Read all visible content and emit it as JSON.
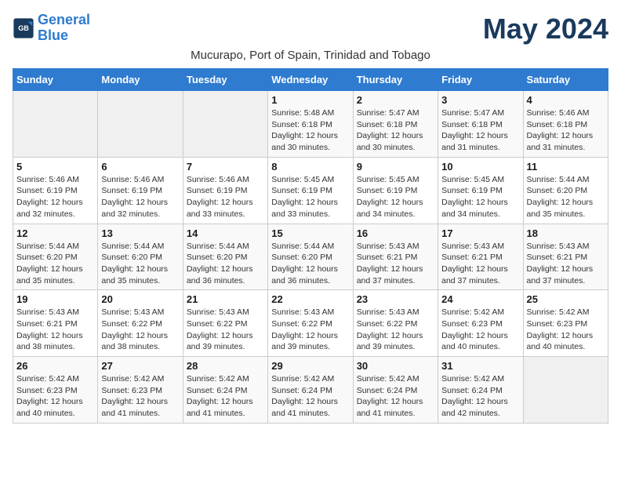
{
  "header": {
    "logo_line1": "General",
    "logo_line2": "Blue",
    "month_title": "May 2024",
    "location": "Mucurapo, Port of Spain, Trinidad and Tobago"
  },
  "days_of_week": [
    "Sunday",
    "Monday",
    "Tuesday",
    "Wednesday",
    "Thursday",
    "Friday",
    "Saturday"
  ],
  "weeks": [
    [
      {
        "day": "",
        "info": ""
      },
      {
        "day": "",
        "info": ""
      },
      {
        "day": "",
        "info": ""
      },
      {
        "day": "1",
        "info": "Sunrise: 5:48 AM\nSunset: 6:18 PM\nDaylight: 12 hours\nand 30 minutes."
      },
      {
        "day": "2",
        "info": "Sunrise: 5:47 AM\nSunset: 6:18 PM\nDaylight: 12 hours\nand 30 minutes."
      },
      {
        "day": "3",
        "info": "Sunrise: 5:47 AM\nSunset: 6:18 PM\nDaylight: 12 hours\nand 31 minutes."
      },
      {
        "day": "4",
        "info": "Sunrise: 5:46 AM\nSunset: 6:18 PM\nDaylight: 12 hours\nand 31 minutes."
      }
    ],
    [
      {
        "day": "5",
        "info": "Sunrise: 5:46 AM\nSunset: 6:19 PM\nDaylight: 12 hours\nand 32 minutes."
      },
      {
        "day": "6",
        "info": "Sunrise: 5:46 AM\nSunset: 6:19 PM\nDaylight: 12 hours\nand 32 minutes."
      },
      {
        "day": "7",
        "info": "Sunrise: 5:46 AM\nSunset: 6:19 PM\nDaylight: 12 hours\nand 33 minutes."
      },
      {
        "day": "8",
        "info": "Sunrise: 5:45 AM\nSunset: 6:19 PM\nDaylight: 12 hours\nand 33 minutes."
      },
      {
        "day": "9",
        "info": "Sunrise: 5:45 AM\nSunset: 6:19 PM\nDaylight: 12 hours\nand 34 minutes."
      },
      {
        "day": "10",
        "info": "Sunrise: 5:45 AM\nSunset: 6:19 PM\nDaylight: 12 hours\nand 34 minutes."
      },
      {
        "day": "11",
        "info": "Sunrise: 5:44 AM\nSunset: 6:20 PM\nDaylight: 12 hours\nand 35 minutes."
      }
    ],
    [
      {
        "day": "12",
        "info": "Sunrise: 5:44 AM\nSunset: 6:20 PM\nDaylight: 12 hours\nand 35 minutes."
      },
      {
        "day": "13",
        "info": "Sunrise: 5:44 AM\nSunset: 6:20 PM\nDaylight: 12 hours\nand 35 minutes."
      },
      {
        "day": "14",
        "info": "Sunrise: 5:44 AM\nSunset: 6:20 PM\nDaylight: 12 hours\nand 36 minutes."
      },
      {
        "day": "15",
        "info": "Sunrise: 5:44 AM\nSunset: 6:20 PM\nDaylight: 12 hours\nand 36 minutes."
      },
      {
        "day": "16",
        "info": "Sunrise: 5:43 AM\nSunset: 6:21 PM\nDaylight: 12 hours\nand 37 minutes."
      },
      {
        "day": "17",
        "info": "Sunrise: 5:43 AM\nSunset: 6:21 PM\nDaylight: 12 hours\nand 37 minutes."
      },
      {
        "day": "18",
        "info": "Sunrise: 5:43 AM\nSunset: 6:21 PM\nDaylight: 12 hours\nand 37 minutes."
      }
    ],
    [
      {
        "day": "19",
        "info": "Sunrise: 5:43 AM\nSunset: 6:21 PM\nDaylight: 12 hours\nand 38 minutes."
      },
      {
        "day": "20",
        "info": "Sunrise: 5:43 AM\nSunset: 6:22 PM\nDaylight: 12 hours\nand 38 minutes."
      },
      {
        "day": "21",
        "info": "Sunrise: 5:43 AM\nSunset: 6:22 PM\nDaylight: 12 hours\nand 39 minutes."
      },
      {
        "day": "22",
        "info": "Sunrise: 5:43 AM\nSunset: 6:22 PM\nDaylight: 12 hours\nand 39 minutes."
      },
      {
        "day": "23",
        "info": "Sunrise: 5:43 AM\nSunset: 6:22 PM\nDaylight: 12 hours\nand 39 minutes."
      },
      {
        "day": "24",
        "info": "Sunrise: 5:42 AM\nSunset: 6:23 PM\nDaylight: 12 hours\nand 40 minutes."
      },
      {
        "day": "25",
        "info": "Sunrise: 5:42 AM\nSunset: 6:23 PM\nDaylight: 12 hours\nand 40 minutes."
      }
    ],
    [
      {
        "day": "26",
        "info": "Sunrise: 5:42 AM\nSunset: 6:23 PM\nDaylight: 12 hours\nand 40 minutes."
      },
      {
        "day": "27",
        "info": "Sunrise: 5:42 AM\nSunset: 6:23 PM\nDaylight: 12 hours\nand 41 minutes."
      },
      {
        "day": "28",
        "info": "Sunrise: 5:42 AM\nSunset: 6:24 PM\nDaylight: 12 hours\nand 41 minutes."
      },
      {
        "day": "29",
        "info": "Sunrise: 5:42 AM\nSunset: 6:24 PM\nDaylight: 12 hours\nand 41 minutes."
      },
      {
        "day": "30",
        "info": "Sunrise: 5:42 AM\nSunset: 6:24 PM\nDaylight: 12 hours\nand 41 minutes."
      },
      {
        "day": "31",
        "info": "Sunrise: 5:42 AM\nSunset: 6:24 PM\nDaylight: 12 hours\nand 42 minutes."
      },
      {
        "day": "",
        "info": ""
      }
    ]
  ]
}
